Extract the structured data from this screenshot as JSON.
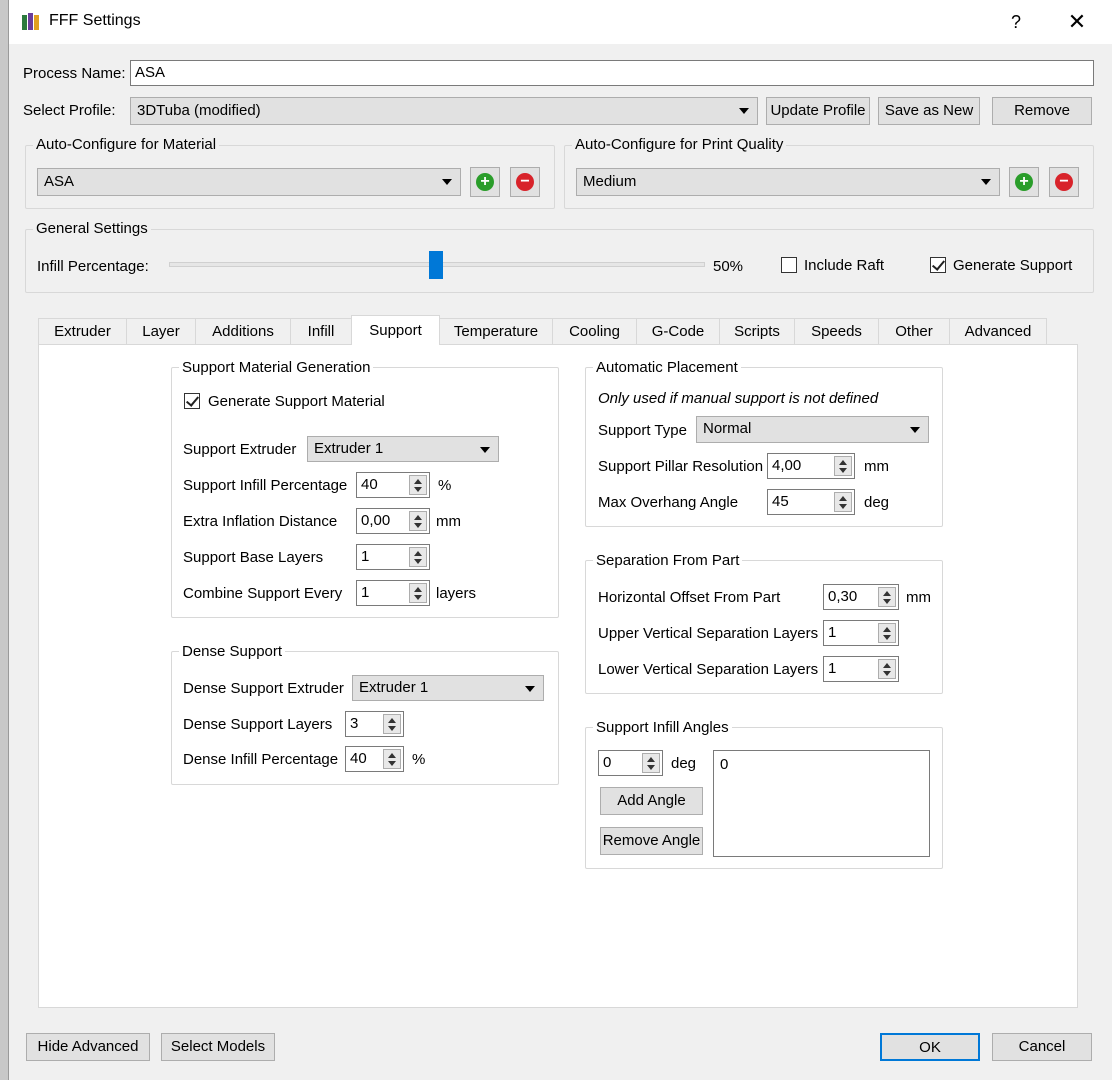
{
  "window": {
    "title": "FFF Settings",
    "help": "?",
    "close": "✕"
  },
  "process": {
    "label": "Process Name:",
    "value": "ASA"
  },
  "profile": {
    "label": "Select Profile:",
    "selected": "3DTuba (modified)",
    "update_button": "Update Profile",
    "save_new_button": "Save as New",
    "remove_button": "Remove"
  },
  "material": {
    "group_title": "Auto-Configure for Material",
    "selected": "ASA"
  },
  "quality": {
    "group_title": "Auto-Configure for Print Quality",
    "selected": "Medium"
  },
  "general": {
    "group_title": "General Settings",
    "infill_label": "Infill Percentage:",
    "infill_value": "50%",
    "infill_fraction": 0.5,
    "include_raft": {
      "label": "Include Raft",
      "checked": false
    },
    "generate_support": {
      "label": "Generate Support",
      "checked": true
    }
  },
  "tabs": [
    "Extruder",
    "Layer",
    "Additions",
    "Infill",
    "Support",
    "Temperature",
    "Cooling",
    "G-Code",
    "Scripts",
    "Speeds",
    "Other",
    "Advanced"
  ],
  "active_tab": "Support",
  "support_gen": {
    "title": "Support Material Generation",
    "generate_label": "Generate Support Material",
    "generate_checked": true,
    "extruder_label": "Support Extruder",
    "extruder_value": "Extruder 1",
    "infill_label": "Support Infill Percentage",
    "infill_value": "40",
    "infill_unit": "%",
    "inflation_label": "Extra Inflation Distance",
    "inflation_value": "0,00",
    "inflation_unit": "mm",
    "base_label": "Support Base Layers",
    "base_value": "1",
    "combine_label": "Combine Support Every",
    "combine_value": "1",
    "combine_unit": "layers"
  },
  "dense": {
    "title": "Dense Support",
    "extruder_label": "Dense Support Extruder",
    "extruder_value": "Extruder 1",
    "layers_label": "Dense Support Layers",
    "layers_value": "3",
    "infill_label": "Dense Infill Percentage",
    "infill_value": "40",
    "infill_unit": "%"
  },
  "placement": {
    "title": "Automatic Placement",
    "note": "Only used if manual support is not defined",
    "type_label": "Support Type",
    "type_value": "Normal",
    "pillar_label": "Support Pillar Resolution",
    "pillar_value": "4,00",
    "pillar_unit": "mm",
    "overhang_label": "Max Overhang Angle",
    "overhang_value": "45",
    "overhang_unit": "deg"
  },
  "separation": {
    "title": "Separation From Part",
    "horizontal_label": "Horizontal Offset From Part",
    "horizontal_value": "0,30",
    "horizontal_unit": "mm",
    "upper_label": "Upper Vertical Separation Layers",
    "upper_value": "1",
    "lower_label": "Lower Vertical Separation Layers",
    "lower_value": "1"
  },
  "angles": {
    "title": "Support Infill Angles",
    "angle_value": "0",
    "angle_unit": "deg",
    "add_button": "Add Angle",
    "remove_button": "Remove Angle",
    "list": [
      "0"
    ]
  },
  "footer": {
    "hide_advanced": "Hide Advanced",
    "select_models": "Select Models",
    "ok": "OK",
    "cancel": "Cancel"
  }
}
